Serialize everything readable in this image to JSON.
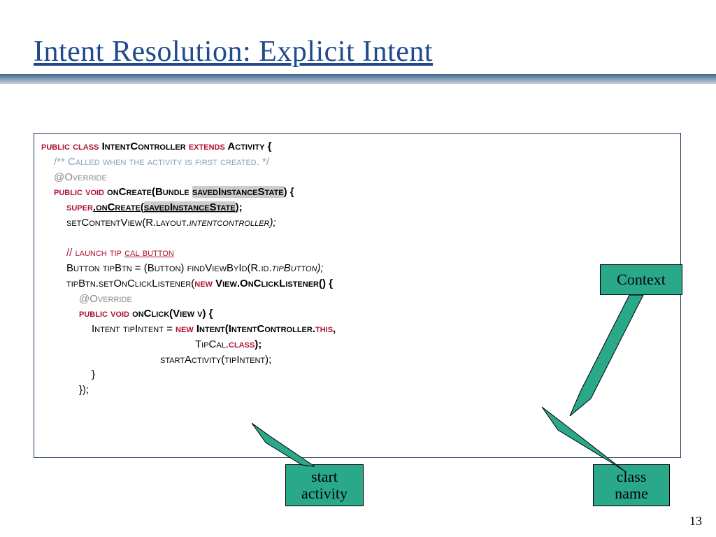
{
  "title": "Intent Resolution: Explicit Intent",
  "code": {
    "l1a": "public class",
    "l1b": " IntentController ",
    "l1c": "extends",
    "l1d": " Activity {",
    "l2": "/** Called when the activity is first created. */",
    "l3": "@Override",
    "l4a": "public void",
    "l4b": " onCreate(Bundle ",
    "l4c": "savedInstanceState",
    "l4d": ") {",
    "l5a": "super",
    "l5b": ".onCreate(",
    "l5c": "savedInstanceState",
    "l5d": ");",
    "l6a": "setContentView(R.layout.",
    "l6b": "intentcontroller",
    "l6c": ");",
    "l7a": "// launch tip ",
    "l7b": "cal button",
    "l8a": "Button tipBtn = (Button) findViewById(R.id.",
    "l8b": "tipButton",
    "l8c": ");",
    "l9a": "tipBtn.setOnClickListener(",
    "l9b": "new",
    "l9c": " View.OnClickListener() {",
    "l10": "@Override",
    "l11a": "public void",
    "l11b": " onClick(View v) {",
    "l12a": "Intent tipIntent = ",
    "l12b": "new",
    "l12c": " Intent(IntentController.",
    "l12d": "this",
    "l12e": ",",
    "l13a": "TipCal.",
    "l13b": "class",
    "l13c": ");",
    "l14": "startActivity(tipIntent);",
    "l15": "}",
    "l16": "});"
  },
  "callouts": {
    "context": "Context",
    "start": "start activity",
    "classname": "class name"
  },
  "page": "13"
}
